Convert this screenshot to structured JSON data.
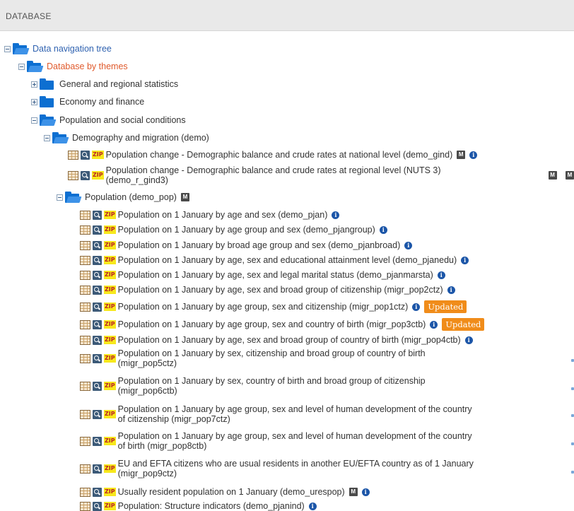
{
  "header": {
    "title": "DATABASE"
  },
  "icons": {
    "table": "table-icon",
    "explore": "data-explorer-icon",
    "zip": "zip-icon",
    "metadata": "metadata-icon",
    "info": "info-icon",
    "folder": "folder-icon",
    "zip_text": "ZIP",
    "metadata_text": "M",
    "info_text": "i"
  },
  "colors": {
    "folder": "#0d6fd1",
    "root_link": "#2f62b0",
    "themes_link": "#e05a2c",
    "badge": "#f08c1a"
  },
  "tree": {
    "root": "Data navigation tree",
    "themes": "Database by themes",
    "general": "General and regional statistics",
    "economy": "Economy and finance",
    "population_social": "Population and social conditions",
    "demography": "Demography and migration (demo)",
    "gind": "Population change - Demographic balance and crude rates at national level (demo_gind)",
    "r_gind3": "Population change - Demographic balance and crude rates at regional level (NUTS 3)\n(demo_r_gind3)",
    "demo_pop": "Population (demo_pop)",
    "datasets": [
      "Population on 1 January by age and sex (demo_pjan)",
      "Population on 1 January by age group and sex (demo_pjangroup)",
      "Population on 1 January by broad age group and sex (demo_pjanbroad)",
      "Population on 1 January by age, sex and educational attainment level (demo_pjanedu)",
      "Population on 1 January by age, sex and legal marital status (demo_pjanmarsta)",
      "Population on 1 January by age, sex and broad group of citizenship (migr_pop2ctz)",
      "Population on 1 January by age group, sex and citizenship (migr_pop1ctz)",
      "Population on 1 January by age group, sex and country of birth (migr_pop3ctb)",
      "Population on 1 January by age, sex and broad group of country of birth (migr_pop4ctb)",
      "Population on 1 January by sex, citizenship and broad group of country of birth\n(migr_pop5ctz)",
      "Population on 1 January by sex, country of birth and broad group of citizenship\n(migr_pop6ctb)",
      "Population on 1 January by age group, sex and level of human development of the country\nof citizenship (migr_pop7ctz)",
      "Population on 1 January by age group, sex and level of human development of the country\nof birth (migr_pop8ctb)",
      "EU and EFTA citizens who are usual residents in another EU/EFTA country as of 1 January\n(migr_pop9ctz)",
      "Usually resident population on 1 January (demo_urespop)",
      "Population: Structure indicators (demo_pjanind)"
    ],
    "updated_badge": "Updated"
  }
}
